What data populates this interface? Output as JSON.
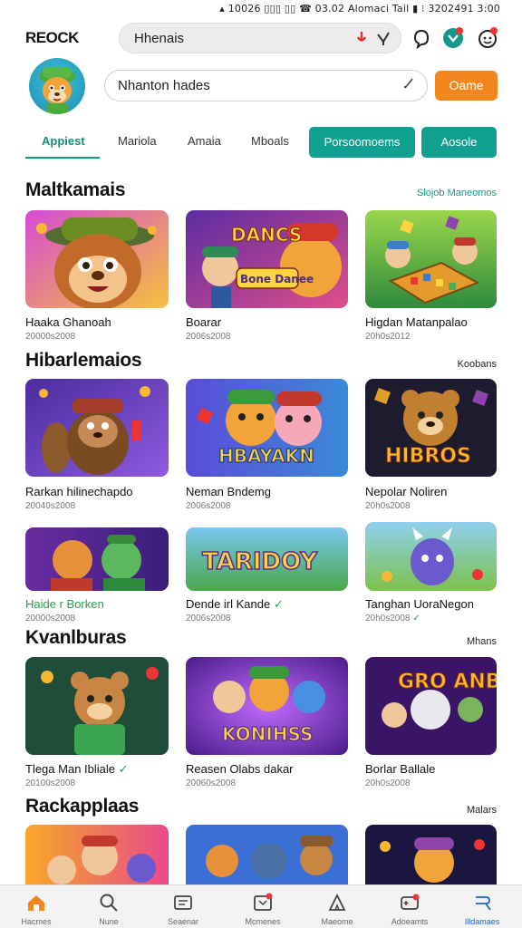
{
  "status_bar": {
    "text": "▴ 10026 ▯▯▯ ▯▯ ☎ 03.02 Alomaci Tail ▮ ⁝ 3202491 3:00"
  },
  "header": {
    "brand": "REOCK",
    "search_value": "Hhenais"
  },
  "profile": {
    "field_value": "Nhanton hades",
    "action_label": "Oame"
  },
  "tabs": {
    "items": [
      "Appiest",
      "Mariola",
      "Amaia",
      "Mboals"
    ],
    "buttons": [
      "Porsoomoems",
      "Aosole"
    ]
  },
  "sections": [
    {
      "title": "Maltkamais",
      "link": "Slojob Maneomos",
      "cards": [
        {
          "title": "Haaka Ghanoah",
          "sub": "20000s2008"
        },
        {
          "title": "Boarar",
          "sub": "2006s2008"
        },
        {
          "title": "Higdan Matanpalao",
          "sub": "20h0s2012"
        }
      ]
    },
    {
      "title": "Hibarlemaios",
      "link": "Koobans",
      "cards": [
        {
          "title": "Rarkan hilinechapdo",
          "sub": "20040s2008",
          "art": ""
        },
        {
          "title": "Neman Bndemg",
          "sub": "2006s2008",
          "art": "HBAYAKN"
        },
        {
          "title": "Nepolar Noliren",
          "sub": "20h0s2008",
          "art": "HIBROS"
        },
        {
          "title": "Haide r Borken",
          "sub": "20000s2008",
          "art": ""
        },
        {
          "title": "Dende irl Kande",
          "sub": "2006s2008",
          "art": "TARIDOY"
        },
        {
          "title": "Tanghan UoraNegon",
          "sub": "20h0s2008",
          "art": ""
        }
      ]
    },
    {
      "title": "Kvanlburas",
      "link": "Mhans",
      "cards": [
        {
          "title": "Tlega Man Ibliale",
          "sub": "20100s2008",
          "art": ""
        },
        {
          "title": "Reasen Olabs dakar",
          "sub": "20060s2008",
          "art": "KONIHSS"
        },
        {
          "title": "Borlar Ballale",
          "sub": "20h0s2008",
          "art": "GRO ANBOSO"
        }
      ]
    },
    {
      "title": "Rackapplaas",
      "link": "Malars",
      "cards": []
    }
  ],
  "art": {
    "dances": "DANCS",
    "dance_sub": "Bone Danee"
  },
  "bottom_nav": [
    "Hacmes",
    "Nune",
    "Seaenar",
    "Mcmenes",
    "Maeome",
    "Adoeamts",
    "Illdamaes"
  ],
  "colors": {
    "accent": "#12998a",
    "orange": "#f3861d",
    "active_nav": "#1f63c9"
  }
}
